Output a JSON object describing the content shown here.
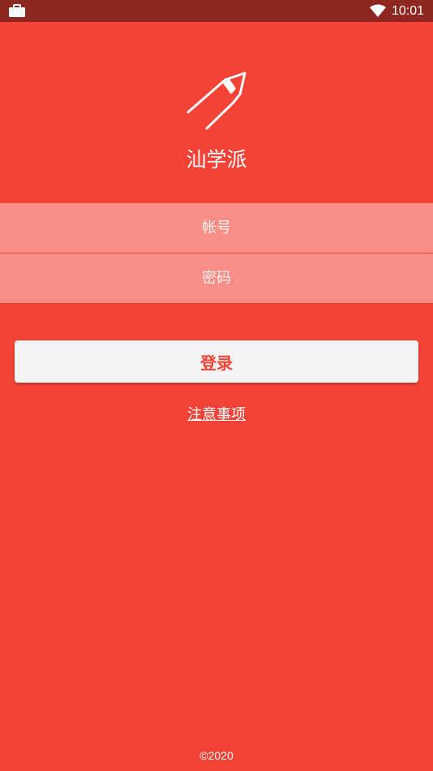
{
  "status_bar": {
    "left_icon": "briefcase-icon",
    "wifi_icon": "wifi-icon",
    "time": "10:01"
  },
  "app": {
    "logo_icon": "pen-nib-icon",
    "name": "汕学派"
  },
  "login_form": {
    "account_placeholder": "帐号",
    "account_value": "",
    "password_placeholder": "密码",
    "password_value": ""
  },
  "actions": {
    "login_label": "登录",
    "notice_link": "注意事项"
  },
  "footer": {
    "copyright": "©2020"
  },
  "colors": {
    "primary": "#f44336",
    "status_bar": "#8f2721",
    "button_bg": "#f4f4f4",
    "button_text": "#f44336"
  }
}
